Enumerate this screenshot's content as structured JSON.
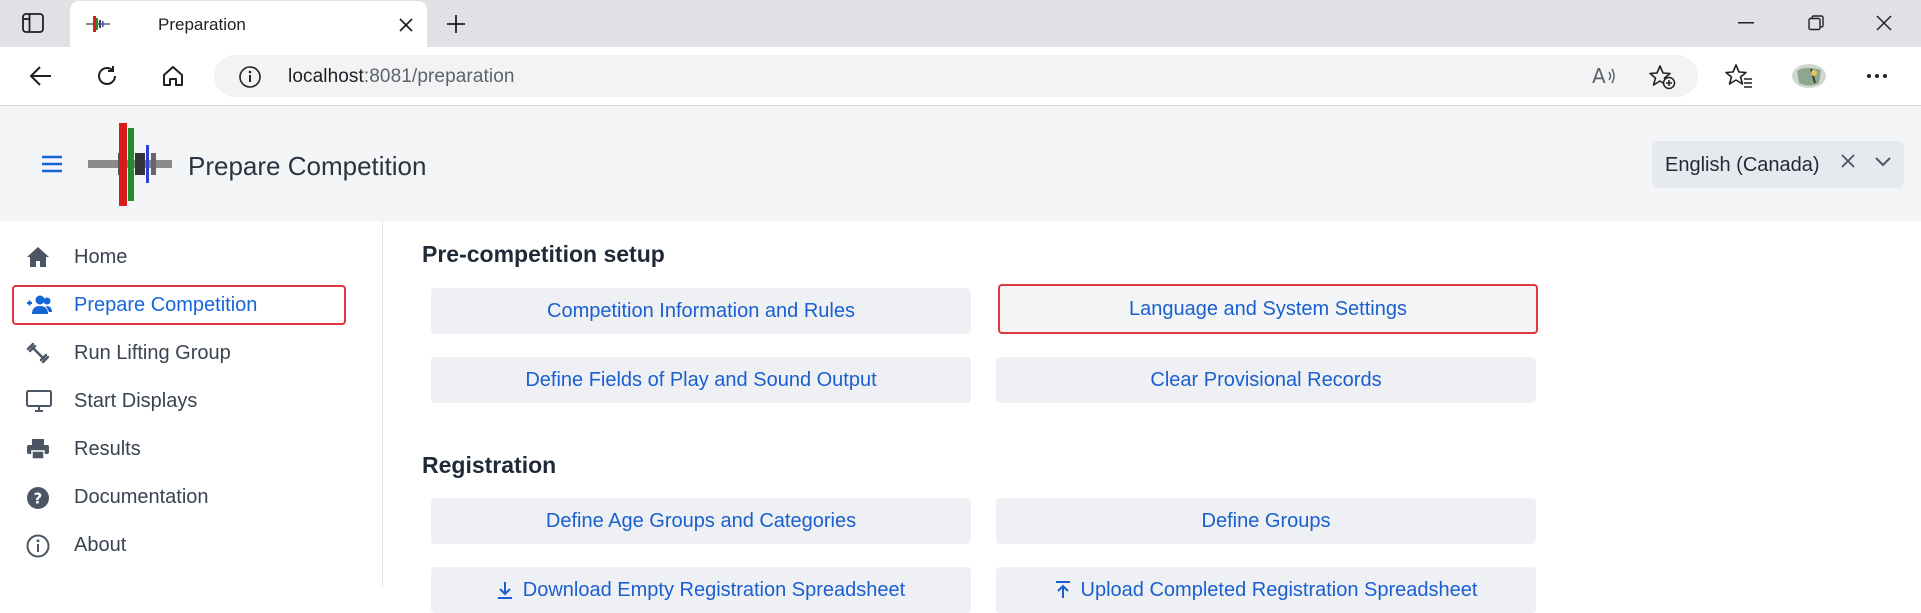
{
  "browser": {
    "tab_title": "Preparation",
    "url_host": "localhost",
    "url_rest": ":8081/preparation"
  },
  "app": {
    "title": "Prepare Competition",
    "language": "English (Canada)"
  },
  "sidebar": {
    "items": [
      {
        "label": "Home",
        "icon": "home-icon"
      },
      {
        "label": "Prepare Competition",
        "icon": "users-icon",
        "active": true
      },
      {
        "label": "Run Lifting Group",
        "icon": "dumbbell-icon"
      },
      {
        "label": "Start Displays",
        "icon": "monitor-icon"
      },
      {
        "label": "Results",
        "icon": "printer-icon"
      },
      {
        "label": "Documentation",
        "icon": "help-icon"
      },
      {
        "label": "About",
        "icon": "info-icon"
      }
    ]
  },
  "main": {
    "sections": [
      {
        "title": "Pre-competition setup",
        "buttons": [
          "Competition Information and Rules",
          "Language and System Settings",
          "Define Fields of Play and Sound Output",
          "Clear Provisional Records"
        ]
      },
      {
        "title": "Registration",
        "buttons": [
          "Define Age Groups and Categories",
          "Define Groups",
          "Download Empty Registration Spreadsheet",
          "Upload Completed Registration Spreadsheet"
        ]
      }
    ]
  },
  "colors": {
    "accent": "#1565d8",
    "highlight_border": "#e0373e",
    "header_bg": "#f4f5f7"
  }
}
